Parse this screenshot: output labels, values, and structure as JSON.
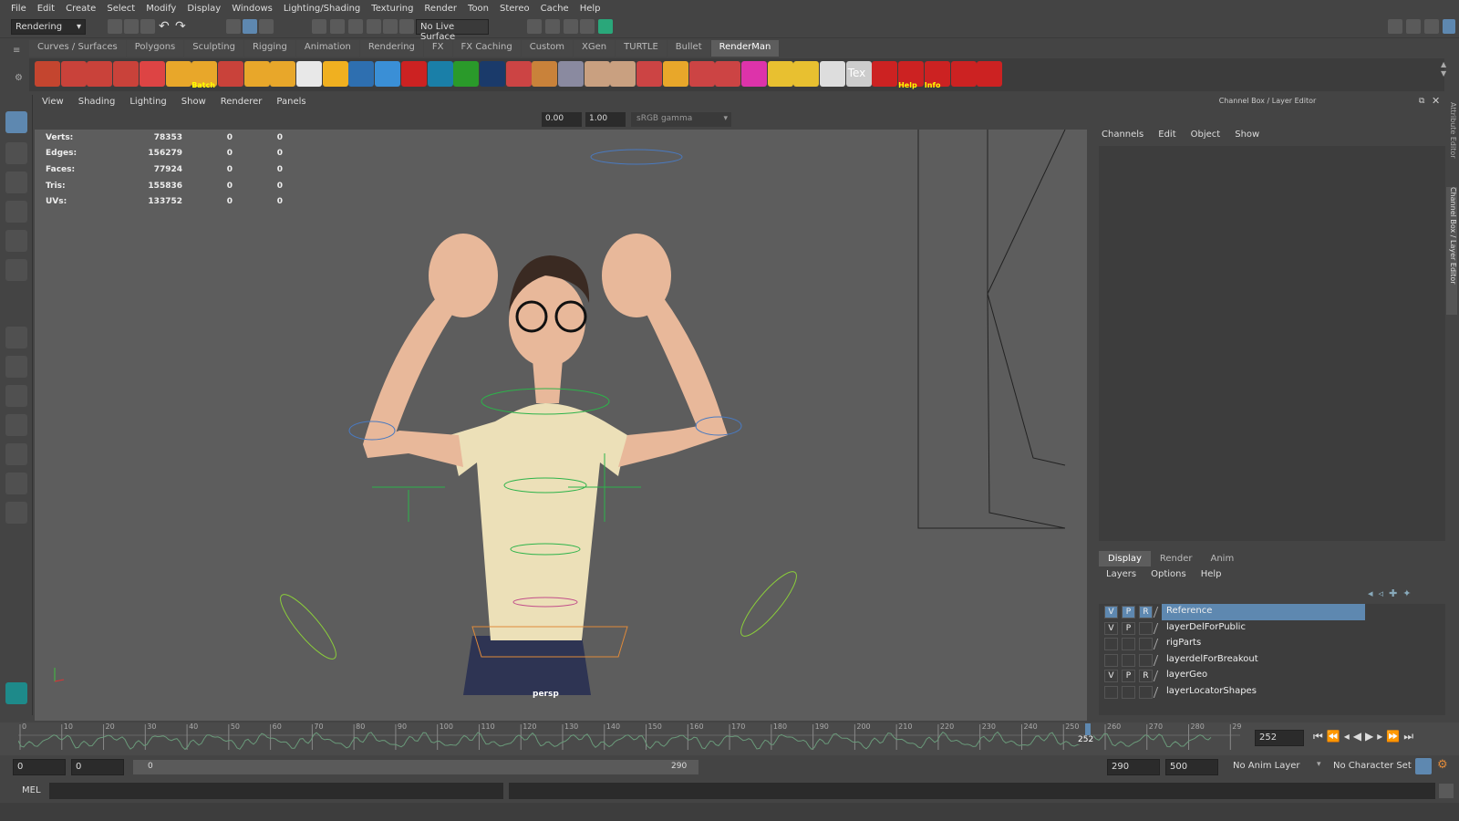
{
  "menubar": [
    "File",
    "Edit",
    "Create",
    "Select",
    "Modify",
    "Display",
    "Windows",
    "Lighting/Shading",
    "Texturing",
    "Render",
    "Toon",
    "Stereo",
    "Cache",
    "Help"
  ],
  "status": {
    "menuset": "Rendering",
    "live_surface": "No Live Surface"
  },
  "shelf_tabs": [
    "Curves / Surfaces",
    "Polygons",
    "Sculpting",
    "Rigging",
    "Animation",
    "Rendering",
    "FX",
    "FX Caching",
    "Custom",
    "XGen",
    "TURTLE",
    "Bullet",
    "RenderMan"
  ],
  "active_shelf_tab": "RenderMan",
  "shelf_labels": {
    "batch": "Batch",
    "tex": "Tex",
    "help": "Help",
    "info": "Info"
  },
  "viewport": {
    "menu": [
      "View",
      "Shading",
      "Lighting",
      "Show",
      "Renderer",
      "Panels"
    ],
    "exposure": "0.00",
    "gamma": "1.00",
    "colorspace": "sRGB gamma",
    "camera_label": "persp",
    "hud": [
      {
        "label": "Verts:",
        "a": "78353",
        "b": "0",
        "c": "0"
      },
      {
        "label": "Edges:",
        "a": "156279",
        "b": "0",
        "c": "0"
      },
      {
        "label": "Faces:",
        "a": "77924",
        "b": "0",
        "c": "0"
      },
      {
        "label": "Tris:",
        "a": "155836",
        "b": "0",
        "c": "0"
      },
      {
        "label": "UVs:",
        "a": "133752",
        "b": "0",
        "c": "0"
      }
    ]
  },
  "channel_box": {
    "title": "Channel Box / Layer Editor",
    "menu": [
      "Channels",
      "Edit",
      "Object",
      "Show"
    ],
    "side_tabs": [
      "Attribute Editor",
      "Channel Box / Layer Editor"
    ]
  },
  "layer_editor": {
    "tabs": [
      "Display",
      "Render",
      "Anim"
    ],
    "active_tab": "Display",
    "menu": [
      "Layers",
      "Options",
      "Help"
    ],
    "layers": [
      {
        "v": "V",
        "p": "P",
        "r": "R",
        "name": "Reference",
        "selected": true
      },
      {
        "v": "V",
        "p": "P",
        "r": "",
        "name": "layerDelForPublic",
        "selected": false
      },
      {
        "v": "",
        "p": "",
        "r": "",
        "name": "rigParts",
        "selected": false
      },
      {
        "v": "",
        "p": "",
        "r": "",
        "name": "layerdelForBreakout",
        "selected": false
      },
      {
        "v": "V",
        "p": "P",
        "r": "R",
        "name": "layerGeo",
        "selected": false
      },
      {
        "v": "",
        "p": "",
        "r": "",
        "name": "layerLocatorShapes",
        "selected": false
      }
    ]
  },
  "timeline": {
    "ticks": [
      "0",
      "10",
      "20",
      "30",
      "40",
      "50",
      "60",
      "70",
      "80",
      "90",
      "100",
      "110",
      "120",
      "130",
      "140",
      "150",
      "160",
      "170",
      "180",
      "190",
      "200",
      "210",
      "220",
      "230",
      "240",
      "250",
      "260",
      "270",
      "280",
      "29"
    ],
    "current_frame_marker": "252",
    "current_frame": "252"
  },
  "range": {
    "start": "0",
    "playback_start": "0",
    "slider_start": "0",
    "slider_end": "290",
    "playback_end": "290",
    "end": "500",
    "anim_layer": "No Anim Layer",
    "character_set": "No Character Set"
  },
  "cmdline": {
    "lang": "MEL"
  },
  "colors": {
    "accent": "#5e88b0",
    "viewport_bg": "#5d5d5d",
    "panel": "#444444"
  }
}
